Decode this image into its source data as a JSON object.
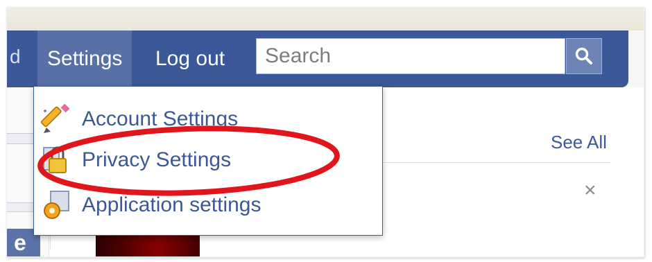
{
  "nav": {
    "partial_item": "d",
    "settings_label": "Settings",
    "logout_label": "Log out"
  },
  "search": {
    "placeholder": "Search",
    "button_icon": "search-icon"
  },
  "dropdown": {
    "items": [
      {
        "label": "Account Settings",
        "icon": "pencil-icon"
      },
      {
        "label": "Privacy Settings",
        "icon": "lock-icon"
      },
      {
        "label": "Application settings",
        "icon": "gear-icon"
      }
    ]
  },
  "content": {
    "see_all_label": "See All",
    "close_label": "×",
    "left_button_label": "e"
  },
  "annotation": {
    "color": "#e0161c",
    "target": "Privacy Settings"
  },
  "colors": {
    "brand": "#3b5998",
    "active_tab": "#5870a6",
    "search_button": "#6d84b4"
  }
}
